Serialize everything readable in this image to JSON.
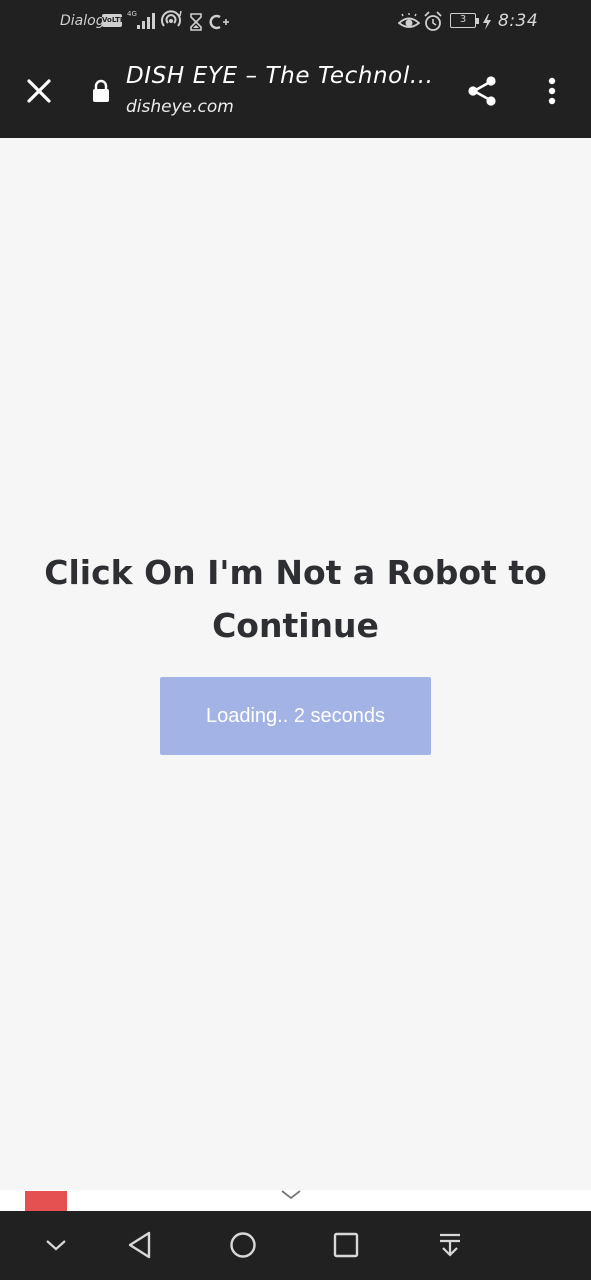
{
  "status_bar": {
    "carrier": "Dialog",
    "volte_badge": "VoLTE",
    "network_type": "4G",
    "battery_level": "3",
    "time": "8:34",
    "icons": [
      "volte-icon",
      "signal-icon",
      "hotspot-icon",
      "hourglass-icon",
      "data-saver-icon",
      "eye-comfort-icon",
      "alarm-icon",
      "battery-icon",
      "charging-icon"
    ]
  },
  "toolbar": {
    "title": "DISH EYE – The Technol...",
    "url": "disheye.com",
    "icons": [
      "close-icon",
      "lock-icon",
      "share-icon",
      "more-vert-icon"
    ]
  },
  "main": {
    "heading": "Click On I'm Not a Robot to Continue",
    "button_label": "Loading.. 2 seconds",
    "button_color": "#a3b3e6"
  },
  "nav_bar": {
    "icons": [
      "hide-nav-icon",
      "back-icon",
      "home-icon",
      "recents-icon",
      "notification-pull-icon"
    ]
  },
  "colors": {
    "system_bars": "#212121",
    "page_background": "#f6f6f6",
    "heading_text": "#2e2f33",
    "ad_logo": "#e55151"
  }
}
